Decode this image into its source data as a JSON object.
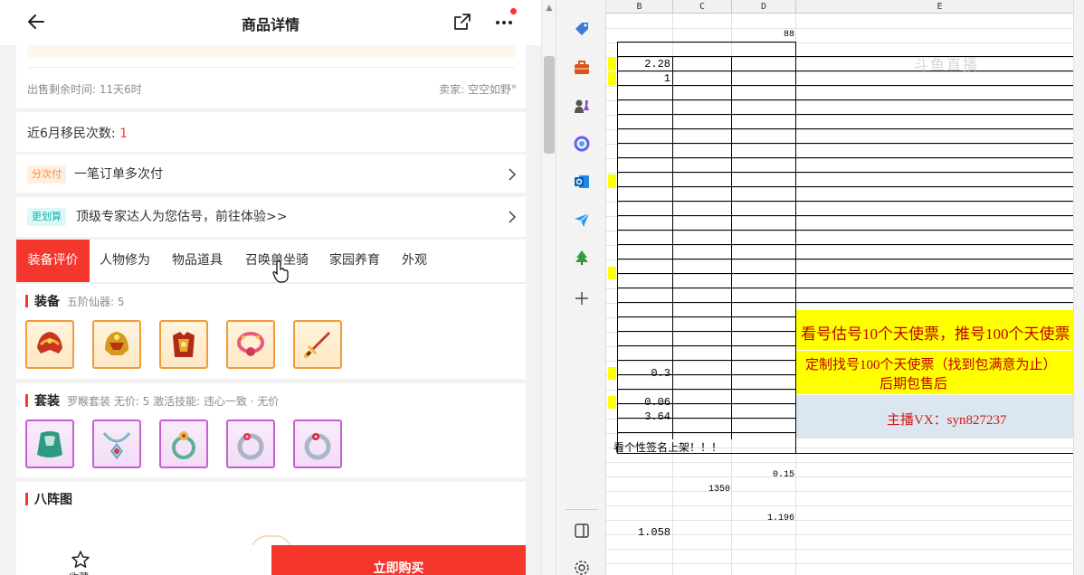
{
  "header": {
    "title": "商品详情"
  },
  "info": {
    "sale_time": "出售剩余时间: 11天6时",
    "seller": "卖家: 空空如野°"
  },
  "migration": {
    "label": "近6月移民次数:",
    "count": "1"
  },
  "installment": {
    "tag": "分次付",
    "text": "一笔订单多次付"
  },
  "evaluation": {
    "tag": "更划算",
    "text": "顶级专家达人为您估号，前往体验>>"
  },
  "tabs": [
    {
      "label": "装备评价",
      "active": true
    },
    {
      "label": "人物修为",
      "active": false
    },
    {
      "label": "物品道具",
      "active": false
    },
    {
      "label": "召唤兽坐骑",
      "active": false
    },
    {
      "label": "家园养育",
      "active": false
    },
    {
      "label": "外观",
      "active": false
    }
  ],
  "equipment": {
    "title": "装备",
    "subtitle": "五阶仙器: 5",
    "items": [
      "helmet",
      "helmet",
      "armor",
      "necklace",
      "sword"
    ]
  },
  "set": {
    "title": "套装",
    "subtitle": "罗睺套装   无价: 5   激活技能: 违心一致 · 无价",
    "items": [
      "cloak",
      "amulet",
      "ring",
      "ring",
      "ring"
    ]
  },
  "bazhen": {
    "title": "八阵图"
  },
  "bottom": {
    "favorite_label": "收藏",
    "buy_label": "立即购买"
  },
  "colors": {
    "accent": "#f4362c",
    "highlight": "#ffff00",
    "info_blue": "#dce6f1",
    "banner_red": "#c00000"
  },
  "sheet": {
    "columns": [
      "B",
      "C",
      "D",
      "E"
    ],
    "cells": {
      "d_top": "88",
      "b1": "2.28",
      "b2": "1",
      "b3": "0.3",
      "b4": "0.06",
      "b5": "3.64",
      "d_low1": "0.15",
      "c_low": "1350",
      "d_low2": "1.196",
      "b_low": "1.058"
    },
    "banner1": "看号估号10个天使票，推号100个天使票",
    "banner2_line1": "定制找号100个天使票（找到包满意为止）",
    "banner2_line2": "后期包售后",
    "banner3": "主播VX：syn827237",
    "notice": "看个性签名上架！！！",
    "watermark": "斗鱼直播"
  }
}
